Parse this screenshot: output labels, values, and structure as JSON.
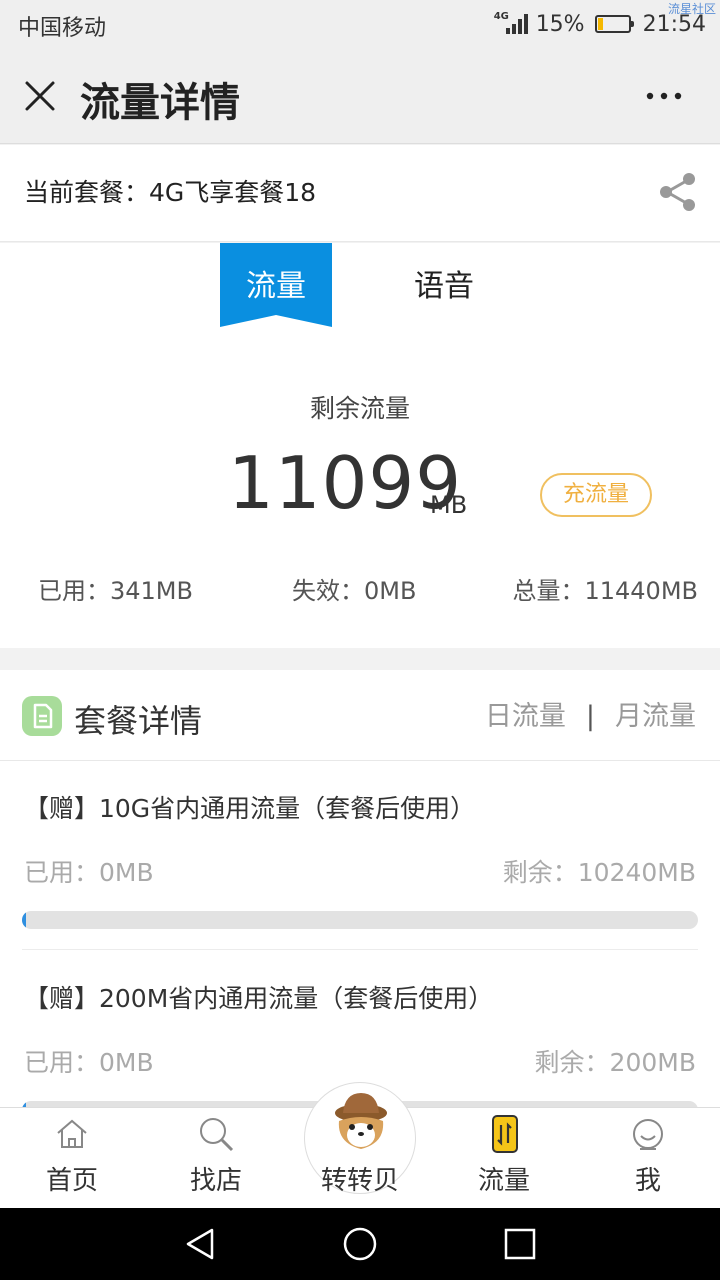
{
  "status_bar": {
    "carrier": "中国移动",
    "network": "4G",
    "battery_percent": "15%",
    "battery_level": 0.15,
    "time": "21:54",
    "watermark": "流星社区"
  },
  "header": {
    "title": "流量详情",
    "close_icon": "close-icon",
    "more_icon": "more-icon"
  },
  "plan": {
    "label": "当前套餐：4G飞享套餐18",
    "share_icon": "share-icon"
  },
  "tabs": [
    {
      "label": "流量",
      "active": true
    },
    {
      "label": "语音",
      "active": false
    }
  ],
  "usage": {
    "remain_label": "剩余流量",
    "remain_value": "11099",
    "remain_unit": "MB",
    "recharge_label": "充流量",
    "used": "已用：341MB",
    "expired": "失效：0MB",
    "total": "总量：11440MB"
  },
  "details": {
    "title": "套餐详情",
    "daily_label": "日流量",
    "separator": "|",
    "monthly_label": "月流量",
    "items": [
      {
        "name": "【赠】10G省内通用流量（套餐后使用）",
        "used": "已用：0MB",
        "remain": "剩余：10240MB",
        "used_fraction": 0.0
      },
      {
        "name": "【赠】200M省内通用流量（套餐后使用）",
        "used": "已用：0MB",
        "remain": "剩余：200MB",
        "used_fraction": 0.0
      }
    ]
  },
  "bottom_nav": [
    {
      "label": "首页",
      "icon": "home-icon"
    },
    {
      "label": "找店",
      "icon": "search-icon"
    },
    {
      "label": "转转贝",
      "icon": "mascot-icon"
    },
    {
      "label": "流量",
      "icon": "data-flow-icon"
    },
    {
      "label": "我",
      "icon": "profile-icon"
    }
  ],
  "colors": {
    "accent": "#0a8fe0",
    "recharge": "#f0b040",
    "progress": "#2f8fe0"
  }
}
